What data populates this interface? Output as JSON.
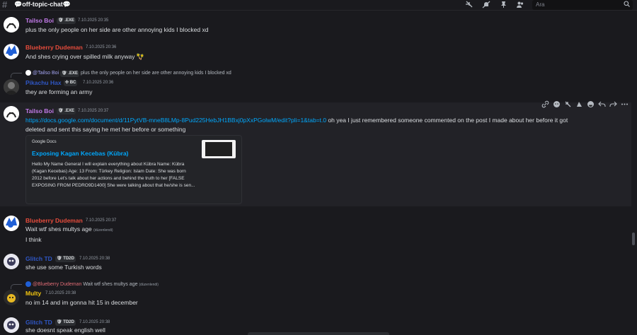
{
  "header": {
    "channel_name": "💬off-topic-chat💬",
    "search_placeholder": "Ara"
  },
  "messages": [
    {
      "username": "Tailso Boi",
      "name_color": "#c27ae8",
      "badge": "🛡 .EXE",
      "timestamp": "7.10.2025 20:35",
      "text": "plus the only people on her side are other annoying kids I blocked xd"
    },
    {
      "username": "Blueberry Dudeman",
      "name_color": "#e74c3c",
      "timestamp": "7.10.2025 20:36",
      "text": "And shes crying over spilled milk anyway 🪇"
    },
    {
      "reply_to_name": "@Tailso Boi",
      "reply_badge": "🛡 .EXE",
      "reply_text": "plus the only people on her side are other annoying kids I blocked xd",
      "username": "Pikachu Hax",
      "name_color": "#2f56c4",
      "badge": "✣ BC",
      "timestamp": "7.10.2025 20:36",
      "text": "they are forming an army"
    },
    {
      "username": "Tailso Boi",
      "name_color": "#c27ae8",
      "badge": "🛡 .EXE",
      "timestamp": "7.10.2025 20:37",
      "link": "https://docs.google.com/document/d/11PytVB-mneB8LMp-8Pud225HebJH1BBxj0pXxPGolwM/edit?pli=1&tab=t.0",
      "text_after_link": " oh yea I just remembered someone commented on the post I made about her before it got",
      "text_line2": "deleted and sent this saying he met her before or something",
      "embed": {
        "provider": "Google Docs",
        "title": "Exposing Kagan Kecebas (Kübra)",
        "description": "Hello My Name General I will explain everything about Kübra Name: Kübra (Kagan Kecebas) Age: 13 From: Türkey Religion: Islam Date: She was born 2012 before Let's talk about her actions and behind the truth to her [FALSE EXPOSING FROM PEDRO9D1400] She were talking about that he/she is sen..."
      }
    },
    {
      "username": "Blueberry Dudeman",
      "name_color": "#e74c3c",
      "timestamp": "7.10.2025 20:37",
      "text": "Wait wtf shes multys age",
      "edited": "(düzenlendi)",
      "text2": "I think"
    },
    {
      "username": "Glitch TD",
      "name_color": "#2f56c4",
      "badge": "🛡 TD2D",
      "timestamp": "7.10.2025 20:38",
      "text": "she use some Turkish words"
    },
    {
      "reply_to_name": "@Blueberry Dudeman",
      "reply_text": "Wait wtf shes multys age",
      "reply_edited": "(düzenlendi)",
      "username": "Multy",
      "name_color": "#f1c40f",
      "timestamp": "7.10.2025 20:38",
      "text": "no im 14 and im gonna hit 15 in december"
    },
    {
      "username": "Glitch TD",
      "name_color": "#2f56c4",
      "badge": "🛡 TD2D",
      "timestamp": "7.10.2025 20:38",
      "text": "she doesnt speak english well"
    }
  ],
  "icons": {
    "header": [
      "threads-icon",
      "mute-bell-icon",
      "pin-icon",
      "members-icon"
    ],
    "toolbar": [
      "copy-link-icon",
      "react-icon-1",
      "react-icon-2",
      "react-icon-3",
      "add-reaction-icon",
      "reply-icon",
      "forward-icon",
      "more-icon"
    ]
  },
  "colors": {
    "background": "#1a1a1e",
    "link": "#00a8fc"
  }
}
